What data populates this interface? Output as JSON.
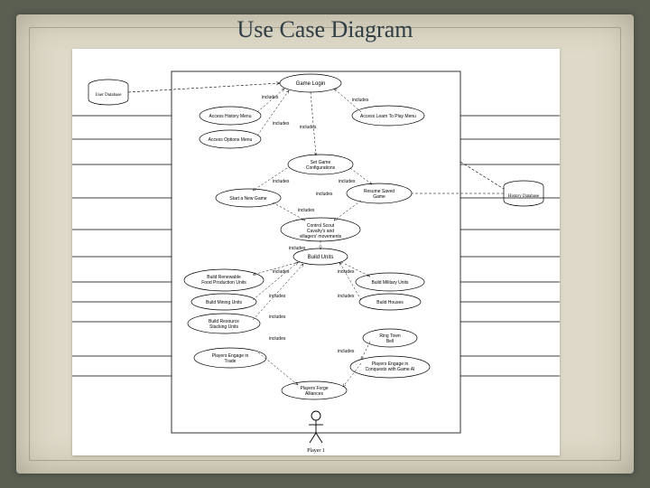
{
  "title": "Use Case Diagram",
  "actor": "Player 1",
  "rel": "includes",
  "db": {
    "user": "User\nDatabase",
    "history": "History\nDatabase"
  },
  "uc": {
    "gameLogin": "Game Login",
    "accessHistory": "Access History Menu",
    "learnToPlay": "Access Learn To Play Menu",
    "accessOptions": "Access Options Menu",
    "setConfig1": "Set Game",
    "setConfig2": "Configurations",
    "startNew": "Start a New Game",
    "resume1": "Resume Saved",
    "resume2": "Game",
    "control1": "Control Scout",
    "control2": "Cavalry's and",
    "control3": "villagers' movements",
    "buildUnits": "Build Units",
    "foodProd1": "Build Renewable",
    "foodProd2": "Food Production Units",
    "military": "Build Military Units",
    "mining": "Build Mining Units",
    "houses": "Build Houses",
    "stacking1": "Build Resource",
    "stacking2": "Stacking Units",
    "ringBell1": "Ring Town",
    "ringBell2": "Bell",
    "trade1": "Players Engage in",
    "trade2": "Trade",
    "conquest1": "Players Engage in",
    "conquest2": "Conquests with Game AI",
    "alliance1": "Players Forge",
    "alliance2": "Alliances"
  }
}
